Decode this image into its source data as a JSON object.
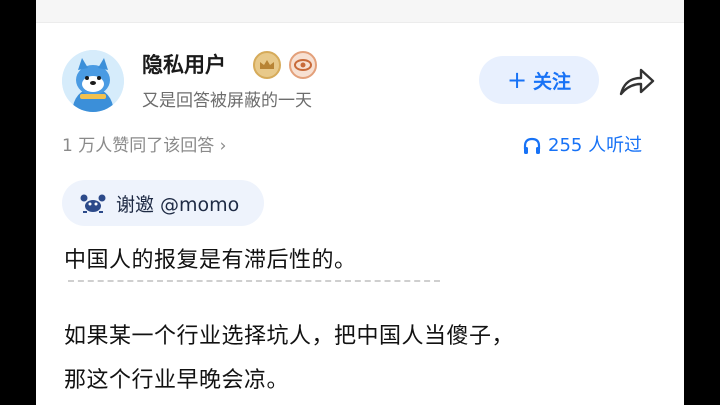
{
  "author": {
    "name": "隐私用户",
    "bio": "又是回答被屏蔽的一天"
  },
  "follow_button": {
    "plus": "+",
    "label": "关注"
  },
  "stats": {
    "likes_text": "1 万人赞同了该回答",
    "likes_chevron": "›",
    "listen_text": "255 人听过"
  },
  "invite": {
    "label": "谢邀 @momo"
  },
  "answer": {
    "paragraph_1": "中国人的报复是有滞后性的。",
    "paragraph_2_line_1": "如果某一个行业选择坑人，把中国人当傻子，",
    "paragraph_2_line_2": "那这个行业早晚会凉。"
  },
  "colors": {
    "accent": "#1772f6",
    "follow_bg": "#e8f0fe",
    "invite_bg": "#eef3fc",
    "text_primary": "#121212",
    "text_secondary": "#8a8a8a"
  },
  "icons": {
    "share": "share-arrow-icon",
    "listen": "headphones-icon",
    "invite": "crab-mascot-icon",
    "badge_1": "crown-badge-icon",
    "badge_2": "eye-badge-icon"
  }
}
